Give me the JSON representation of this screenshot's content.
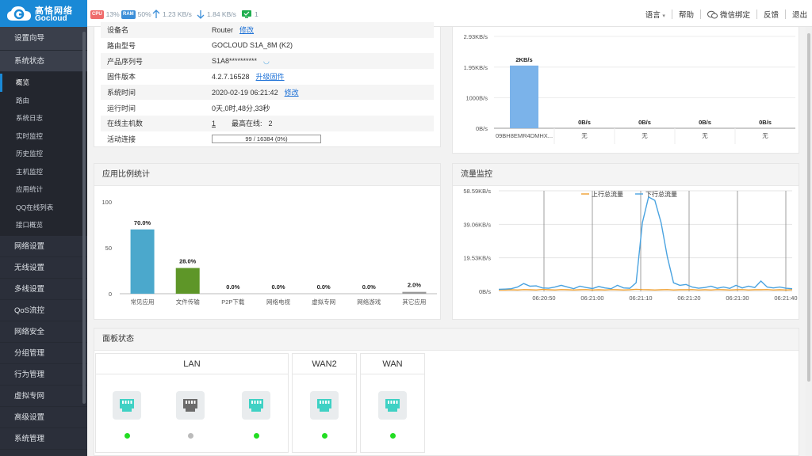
{
  "brand": {
    "name": "高恪网络",
    "sub": "Gocloud"
  },
  "status": {
    "cpu_chip": "CPU",
    "cpu": "13%",
    "ram_chip": "RAM",
    "ram": "50%",
    "up": "1.23 KB/s",
    "down": "1.84 KB/s",
    "online": "1"
  },
  "toplinks": {
    "language": "语言",
    "help": "帮助",
    "wechat": "微信绑定",
    "feedback": "反馈",
    "logout": "退出"
  },
  "sidebar": {
    "top_items": [
      "设置向导",
      "系统状态"
    ],
    "sub_items": [
      "概览",
      "路由",
      "系统日志",
      "实时监控",
      "历史监控",
      "主机监控",
      "应用统计",
      "QQ在线列表",
      "接口概览"
    ],
    "bottom_items": [
      "网络设置",
      "无线设置",
      "多线设置",
      "QoS流控",
      "网络安全",
      "分组管理",
      "行为管理",
      "虚拟专网",
      "高级设置",
      "系统管理"
    ]
  },
  "device": {
    "rows": [
      {
        "label": "设备名",
        "value": "Router",
        "link": "修改"
      },
      {
        "label": "路由型号",
        "value": "GOCLOUD S1A_8M (K2)"
      },
      {
        "label": "产品序列号",
        "value": "S1A8**********"
      },
      {
        "label": "固件版本",
        "value": "4.2.7.16528",
        "link": "升级固件"
      },
      {
        "label": "系统时间",
        "value": "2020-02-19 06:21:42",
        "link": "修改"
      },
      {
        "label": "运行时间",
        "value": "0天,0时,48分,33秒"
      },
      {
        "label": "在线主机数",
        "value": "1",
        "extra_label": "最高在线:",
        "extra_value": "2"
      },
      {
        "label": "活动连接",
        "progress": "99 / 16384 (0%)"
      }
    ]
  },
  "host_chart": {
    "chart_data": {
      "type": "bar",
      "categories": [
        "09BH8EMR4DMHX...",
        "无",
        "无",
        "无",
        "无"
      ],
      "values": [
        2,
        0,
        0,
        0,
        0
      ],
      "value_labels": [
        "2KB/s",
        "0B/s",
        "0B/s",
        "0B/s",
        "0B/s"
      ],
      "yticks": [
        "2.93KB/s",
        "1.95KB/s",
        "1000B/s",
        "0B/s"
      ],
      "ytick_values": [
        2.93,
        1.95,
        0.977,
        0
      ],
      "ylim": [
        0,
        2.93
      ],
      "color": "#7bb3ea"
    }
  },
  "app_panel": {
    "title": "应用比例统计",
    "chart_data": {
      "type": "bar",
      "categories": [
        "常见应用",
        "文件传输",
        "P2P下载",
        "网络电视",
        "虚拟专网",
        "网络游戏",
        "其它应用"
      ],
      "values": [
        70.0,
        28.0,
        0.0,
        0.0,
        0.0,
        0.0,
        2.0
      ],
      "value_labels": [
        "70.0%",
        "28.0%",
        "0.0%",
        "0.0%",
        "0.0%",
        "0.0%",
        "2.0%"
      ],
      "yticks": [
        "100",
        "50",
        "0"
      ],
      "ytick_values": [
        100,
        50,
        0
      ],
      "ylim": [
        0,
        100
      ],
      "colors": [
        "#4ba8cc",
        "#5e9628",
        "#999999",
        "#999999",
        "#999999",
        "#999999",
        "#999999"
      ]
    }
  },
  "traffic_panel": {
    "title": "流量监控",
    "chart_data": {
      "type": "line",
      "yticks": [
        "58.59KB/s",
        "39.06KB/s",
        "19.53KB/s",
        "0B/s"
      ],
      "ytick_values": [
        58.59,
        39.06,
        19.53,
        0
      ],
      "ylim": [
        0,
        58.59
      ],
      "xticks": [
        "06:20:50",
        "06:21:00",
        "06:21:10",
        "06:21:20",
        "06:21:30",
        "06:21:40"
      ],
      "series": [
        {
          "name": "上行总流量",
          "color": "#f0a030",
          "values": [
            0.8,
            0.8,
            0.9,
            0.8,
            1.0,
            0.9,
            0.8,
            1.1,
            0.9,
            0.8,
            1.0,
            0.9,
            0.8,
            0.9,
            1.0,
            0.8,
            0.9,
            0.8,
            1.0,
            0.9,
            0.8,
            0.9,
            1.2,
            1.0,
            0.9,
            0.8,
            0.9,
            1.0,
            0.8,
            0.9,
            0.9,
            1.0,
            0.8,
            0.9,
            0.8,
            1.0,
            0.9,
            0.8,
            0.9,
            1.0,
            0.8,
            0.9,
            0.9,
            1.0,
            0.8,
            0.9,
            0.8,
            0.9
          ]
        },
        {
          "name": "下行总流量",
          "color": "#4aa3e0",
          "values": [
            1.2,
            1.3,
            1.5,
            2.5,
            4.5,
            3.0,
            3.2,
            2.0,
            1.8,
            2.5,
            3.5,
            2.5,
            1.5,
            3.0,
            2.2,
            1.6,
            2.8,
            2.0,
            1.5,
            3.5,
            2.0,
            1.8,
            5.0,
            40.0,
            55.0,
            53.0,
            40.0,
            20.0,
            5.0,
            3.5,
            4.0,
            2.5,
            1.8,
            2.2,
            3.0,
            1.8,
            2.5,
            1.7,
            3.5,
            2.0,
            3.0,
            2.2,
            6.0,
            2.5,
            2.0,
            2.5,
            1.8,
            1.5
          ]
        }
      ]
    }
  },
  "panel_status": {
    "title": "面板状态",
    "groups": [
      {
        "name": "LAN",
        "ports": [
          {
            "active": true
          },
          {
            "active": false
          },
          {
            "active": true
          }
        ]
      },
      {
        "name": "WAN2",
        "ports": [
          {
            "active": true
          }
        ]
      },
      {
        "name": "WAN",
        "ports": [
          {
            "active": true
          }
        ]
      }
    ]
  },
  "colors": {
    "accent": "#1a89d6",
    "port_active": "#3fd1c4",
    "port_inactive": "#6b6b6b",
    "led_on": "#22dd22",
    "led_off": "#bbbbbb"
  }
}
